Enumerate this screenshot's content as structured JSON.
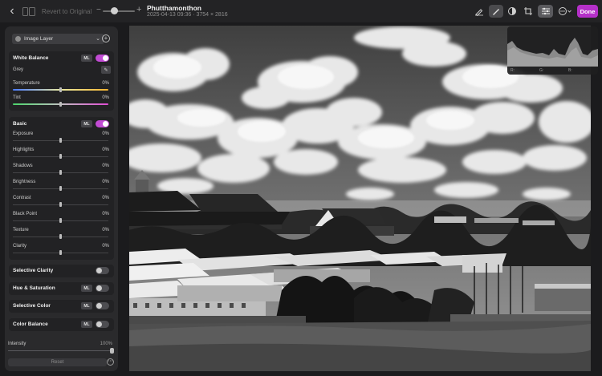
{
  "toolbar": {
    "back_icon": "chevron-left-icon",
    "sidebar_icon": "sidebar-toggle-icon",
    "revert_label": "Revert to Original",
    "zoom_minus": "−",
    "zoom_plus": "+",
    "photo_title": "Phutthamonthon",
    "photo_subtitle": "2025-04-13 09:36 · 3754 × 2816",
    "tools": [
      "markup-icon",
      "retouch-icon",
      "adjust-color-icon",
      "crop-icon",
      "adjustments-icon",
      "more-icon"
    ],
    "done_label": "Done",
    "accent_color": "#b530c9"
  },
  "panel": {
    "layer_select": "Image Layer",
    "white_balance": {
      "title": "White Balance",
      "ml": "ML",
      "enabled": true,
      "mode_label": "Grey",
      "rows": [
        {
          "label": "Temperature",
          "value": "0%"
        },
        {
          "label": "Tint",
          "value": "0%"
        }
      ]
    },
    "basic": {
      "title": "Basic",
      "ml": "ML",
      "enabled": true,
      "rows": [
        {
          "label": "Exposure",
          "value": "0%"
        },
        {
          "label": "Highlights",
          "value": "0%"
        },
        {
          "label": "Shadows",
          "value": "0%"
        },
        {
          "label": "Brightness",
          "value": "0%"
        },
        {
          "label": "Contrast",
          "value": "0%"
        },
        {
          "label": "Black Point",
          "value": "0%"
        },
        {
          "label": "Texture",
          "value": "0%"
        },
        {
          "label": "Clarity",
          "value": "0%"
        }
      ]
    },
    "collapsed_sections": [
      {
        "title": "Selective Clarity",
        "ml": "",
        "enabled": false
      },
      {
        "title": "Hue & Saturation",
        "ml": "ML",
        "enabled": false
      },
      {
        "title": "Selective Color",
        "ml": "ML",
        "enabled": false
      },
      {
        "title": "Color Balance",
        "ml": "ML",
        "enabled": false
      }
    ],
    "intensity": {
      "label": "Intensity",
      "value": "100%",
      "level": 1.0
    },
    "reset_label": "Reset"
  },
  "histogram": {
    "readouts": [
      "R:",
      "G:",
      "B:"
    ]
  }
}
